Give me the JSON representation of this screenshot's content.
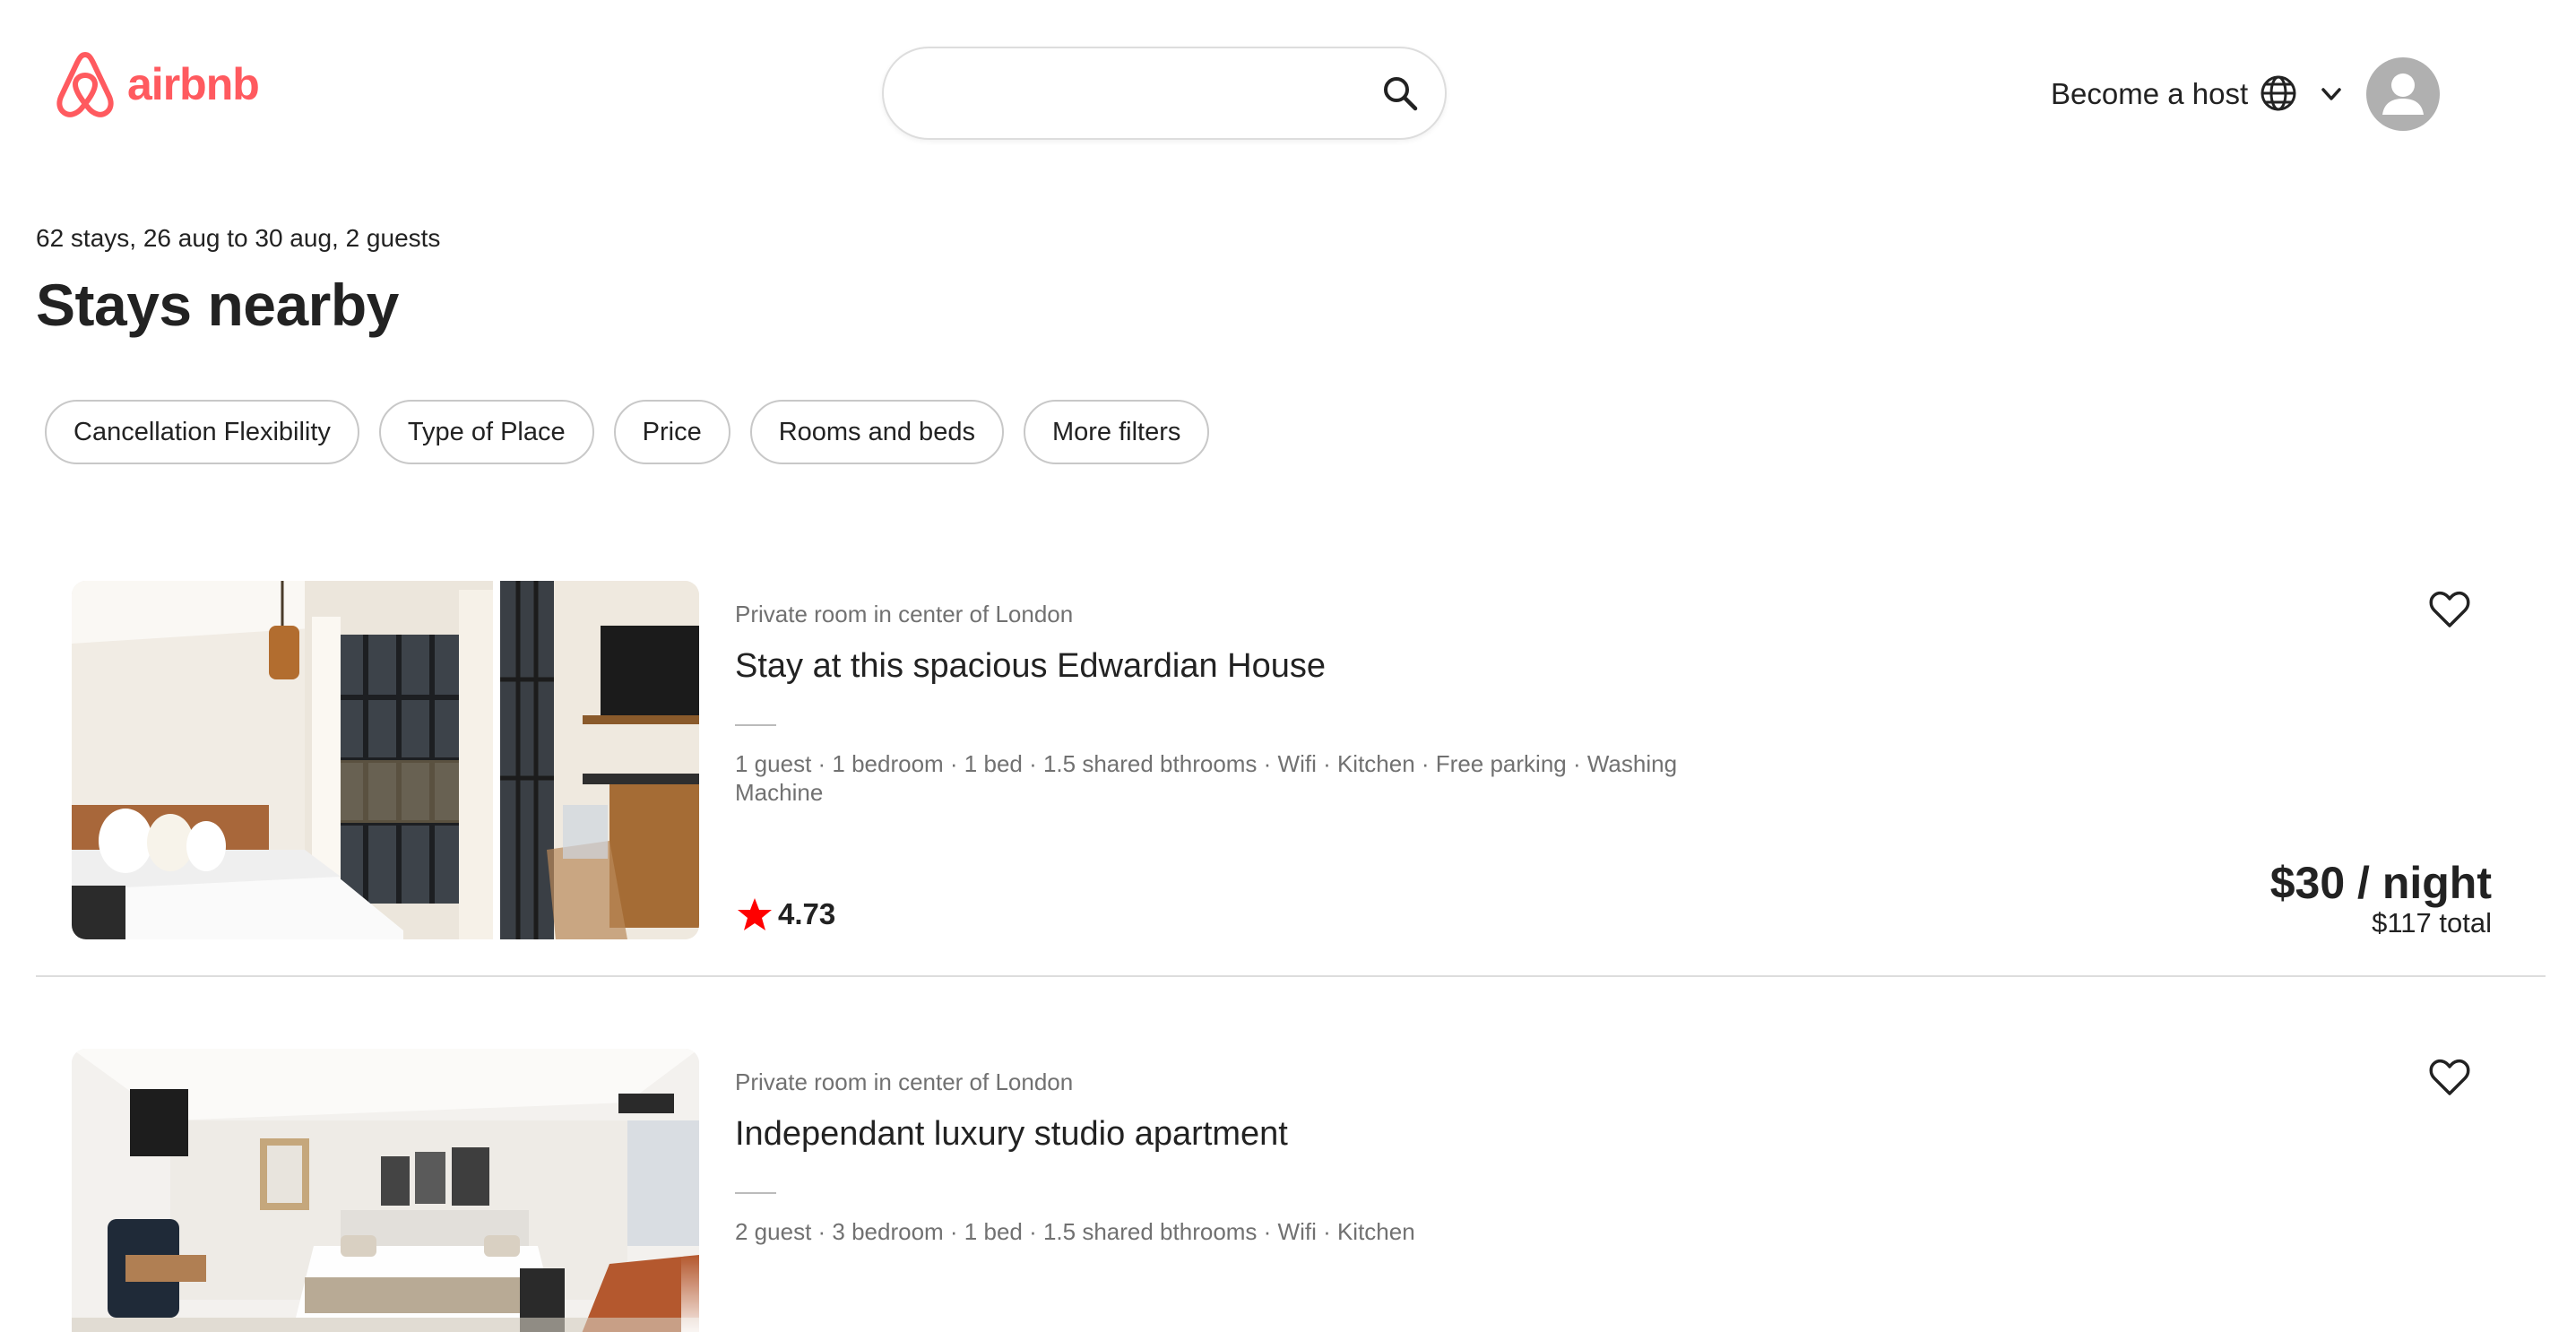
{
  "header": {
    "brand": "airbnb",
    "logo_icon": "airbnb-belo-icon",
    "search": {
      "value": "",
      "placeholder": "",
      "icon": "search-icon"
    },
    "host_label": "Become a host",
    "globe_icon": "globe-icon",
    "menu_icon": "chevron-down-icon",
    "avatar_icon": "user-avatar-icon"
  },
  "results": {
    "summary": "62 stays, 26 aug to 30 aug, 2 guests",
    "title": "Stays nearby"
  },
  "filters": [
    {
      "label": "Cancellation Flexibility"
    },
    {
      "label": "Type of Place"
    },
    {
      "label": "Price"
    },
    {
      "label": "Rooms and beds"
    },
    {
      "label": "More filters"
    }
  ],
  "listings": [
    {
      "room_type": "Private room in center of London",
      "title": "Stay at this spacious Edwardian House",
      "amenities": "1 guest · 1 bedroom · 1 bed · 1.5 shared bthrooms · Wifi · Kitchen · Free parking · Washing Machine",
      "rating": "4.73",
      "price": "$30 / night",
      "total": "$117 total"
    },
    {
      "room_type": "Private room in center of London",
      "title": "Independant luxury studio apartment",
      "amenities": "2 guest · 3 bedroom · 1 bed · 1.5 shared bthrooms · Wifi · Kitchen"
    }
  ],
  "colors": {
    "brand": "#FF5A5F",
    "star": "#FF0000",
    "text": "#222222",
    "muted": "#717171",
    "border": "#DDDDDD"
  }
}
